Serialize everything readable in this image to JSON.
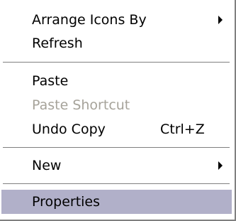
{
  "menu": {
    "items": [
      {
        "label": "Arrange Icons By",
        "submenu_icon": "chevron-right-icon"
      },
      {
        "label": "Refresh"
      },
      {
        "label": "Paste"
      },
      {
        "label": "Paste Shortcut",
        "disabled": true
      },
      {
        "label": "Undo Copy",
        "shortcut": "Ctrl+Z"
      },
      {
        "label": "New",
        "submenu_icon": "chevron-right-icon"
      },
      {
        "label": "Properties",
        "highlighted": true
      }
    ],
    "colors": {
      "background": "#ffffff",
      "highlight": "#b1b0c9",
      "disabled_text": "#a6a39a",
      "separator": "#808080"
    }
  }
}
